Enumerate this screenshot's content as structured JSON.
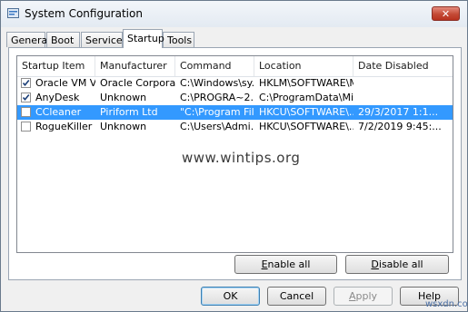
{
  "window": {
    "title": "System Configuration",
    "close_label": "✕"
  },
  "tabs": [
    {
      "label": "General",
      "active": false
    },
    {
      "label": "Boot",
      "active": false
    },
    {
      "label": "Services",
      "active": false
    },
    {
      "label": "Startup",
      "active": true
    },
    {
      "label": "Tools",
      "active": false
    }
  ],
  "table": {
    "columns": [
      "Startup Item",
      "Manufacturer",
      "Command",
      "Location",
      "Date Disabled"
    ],
    "rows": [
      {
        "checked": true,
        "selected": false,
        "cells": [
          "Oracle VM Vi...",
          "Oracle Corpora...",
          "C:\\Windows\\sy...",
          "HKLM\\SOFTWARE\\M...",
          ""
        ]
      },
      {
        "checked": true,
        "selected": false,
        "cells": [
          "AnyDesk",
          "Unknown",
          "C:\\PROGRA~2...",
          "C:\\ProgramData\\Mic...",
          ""
        ]
      },
      {
        "checked": false,
        "selected": true,
        "cells": [
          "CCleaner",
          "Piriform Ltd",
          "\"C:\\Program Fil...",
          "HKCU\\SOFTWARE\\...",
          "29/3/2017 1:1..."
        ]
      },
      {
        "checked": false,
        "selected": false,
        "cells": [
          "RogueKiller ...",
          "Unknown",
          "C:\\Users\\Admi...",
          "HKCU\\SOFTWARE\\...",
          "7/2/2019 9:45:..."
        ]
      }
    ]
  },
  "actions": {
    "enable_all": {
      "hotkey": "E",
      "rest": "nable all"
    },
    "disable_all": {
      "hotkey": "D",
      "rest": "isable all"
    }
  },
  "footer": {
    "ok": "OK",
    "cancel": "Cancel",
    "apply": {
      "hotkey": "A",
      "rest": "pply"
    },
    "help": "Help"
  },
  "watermark": "www.wintips.org",
  "corner_watermark": "wsxdn.com",
  "colors": {
    "selection": "#3399ff",
    "close_button": "#c44a36"
  }
}
